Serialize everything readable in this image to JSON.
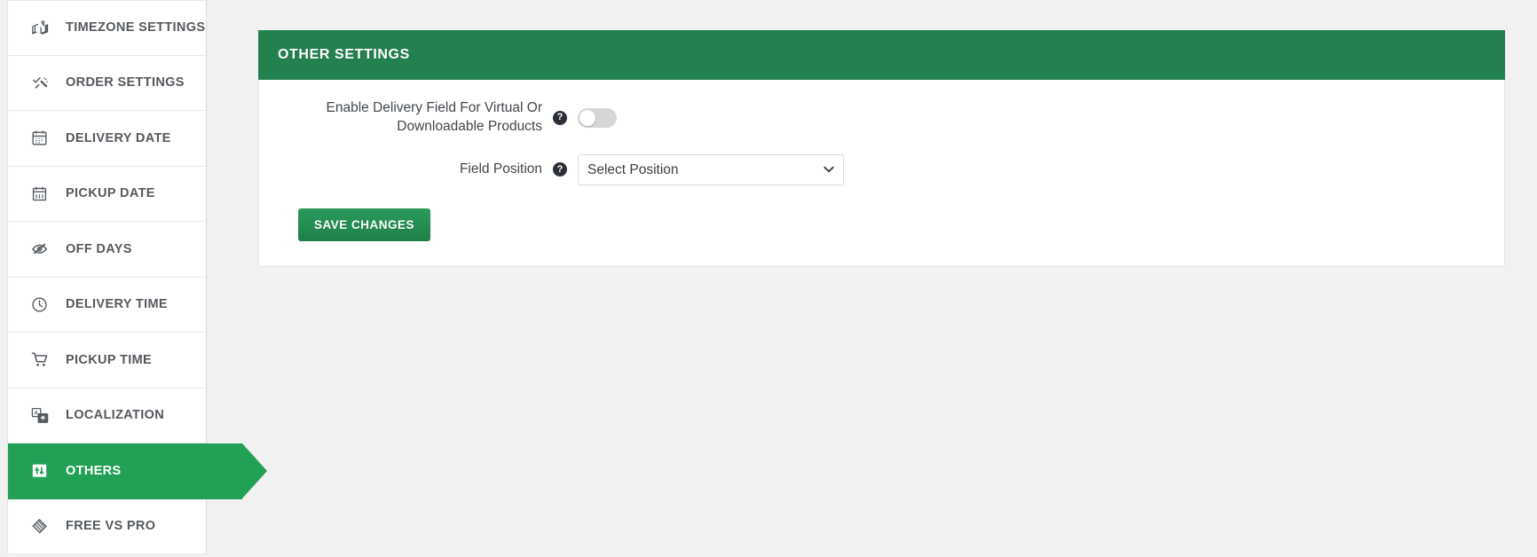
{
  "theme": {
    "header_green": "#23804f",
    "active_green": "#22a055",
    "button_green": "#2a9a5c",
    "page_background": "#f1f1f1",
    "label_gray": "#55595e"
  },
  "sidebar": {
    "items": [
      {
        "label": "TIMEZONE SETTINGS",
        "icon": "map-flag-icon",
        "active": false
      },
      {
        "label": "ORDER SETTINGS",
        "icon": "order-check-icon",
        "active": false
      },
      {
        "label": "DELIVERY DATE",
        "icon": "calendar-icon",
        "active": false
      },
      {
        "label": "PICKUP DATE",
        "icon": "calendar-pickup-icon",
        "active": false
      },
      {
        "label": "OFF DAYS",
        "icon": "eye-slash-icon",
        "active": false
      },
      {
        "label": "DELIVERY TIME",
        "icon": "clock-icon",
        "active": false
      },
      {
        "label": "PICKUP TIME",
        "icon": "shopping-cart-icon",
        "active": false
      },
      {
        "label": "LOCALIZATION",
        "icon": "language-translate-icon",
        "active": false
      },
      {
        "label": "OTHERS",
        "icon": "sliders-icon",
        "active": true
      },
      {
        "label": "FREE VS PRO",
        "icon": "diamond-compare-icon",
        "active": false
      }
    ]
  },
  "main": {
    "panel_title": "OTHER SETTINGS",
    "fields": {
      "enable_delivery_virtual": {
        "label": "Enable Delivery Field For Virtual Or Downloadable Products",
        "help": "?",
        "toggle_state": "off"
      },
      "field_position": {
        "label": "Field Position",
        "help": "?",
        "selected": "Select Position",
        "options": [
          "Select Position"
        ]
      }
    },
    "save_button": "SAVE CHANGES"
  }
}
